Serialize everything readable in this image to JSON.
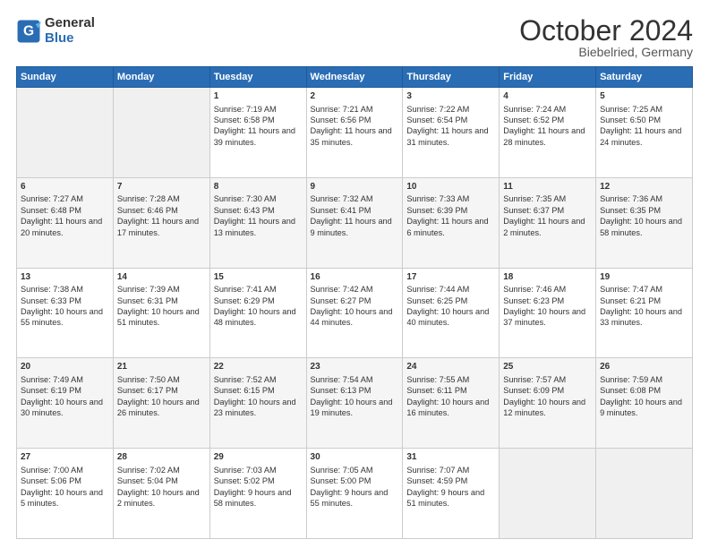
{
  "logo": {
    "line1": "General",
    "line2": "Blue"
  },
  "header": {
    "month": "October 2024",
    "location": "Biebelried, Germany"
  },
  "weekdays": [
    "Sunday",
    "Monday",
    "Tuesday",
    "Wednesday",
    "Thursday",
    "Friday",
    "Saturday"
  ],
  "weeks": [
    [
      {
        "day": "",
        "content": ""
      },
      {
        "day": "",
        "content": ""
      },
      {
        "day": "1",
        "content": "Sunrise: 7:19 AM\nSunset: 6:58 PM\nDaylight: 11 hours and 39 minutes."
      },
      {
        "day": "2",
        "content": "Sunrise: 7:21 AM\nSunset: 6:56 PM\nDaylight: 11 hours and 35 minutes."
      },
      {
        "day": "3",
        "content": "Sunrise: 7:22 AM\nSunset: 6:54 PM\nDaylight: 11 hours and 31 minutes."
      },
      {
        "day": "4",
        "content": "Sunrise: 7:24 AM\nSunset: 6:52 PM\nDaylight: 11 hours and 28 minutes."
      },
      {
        "day": "5",
        "content": "Sunrise: 7:25 AM\nSunset: 6:50 PM\nDaylight: 11 hours and 24 minutes."
      }
    ],
    [
      {
        "day": "6",
        "content": "Sunrise: 7:27 AM\nSunset: 6:48 PM\nDaylight: 11 hours and 20 minutes."
      },
      {
        "day": "7",
        "content": "Sunrise: 7:28 AM\nSunset: 6:46 PM\nDaylight: 11 hours and 17 minutes."
      },
      {
        "day": "8",
        "content": "Sunrise: 7:30 AM\nSunset: 6:43 PM\nDaylight: 11 hours and 13 minutes."
      },
      {
        "day": "9",
        "content": "Sunrise: 7:32 AM\nSunset: 6:41 PM\nDaylight: 11 hours and 9 minutes."
      },
      {
        "day": "10",
        "content": "Sunrise: 7:33 AM\nSunset: 6:39 PM\nDaylight: 11 hours and 6 minutes."
      },
      {
        "day": "11",
        "content": "Sunrise: 7:35 AM\nSunset: 6:37 PM\nDaylight: 11 hours and 2 minutes."
      },
      {
        "day": "12",
        "content": "Sunrise: 7:36 AM\nSunset: 6:35 PM\nDaylight: 10 hours and 58 minutes."
      }
    ],
    [
      {
        "day": "13",
        "content": "Sunrise: 7:38 AM\nSunset: 6:33 PM\nDaylight: 10 hours and 55 minutes."
      },
      {
        "day": "14",
        "content": "Sunrise: 7:39 AM\nSunset: 6:31 PM\nDaylight: 10 hours and 51 minutes."
      },
      {
        "day": "15",
        "content": "Sunrise: 7:41 AM\nSunset: 6:29 PM\nDaylight: 10 hours and 48 minutes."
      },
      {
        "day": "16",
        "content": "Sunrise: 7:42 AM\nSunset: 6:27 PM\nDaylight: 10 hours and 44 minutes."
      },
      {
        "day": "17",
        "content": "Sunrise: 7:44 AM\nSunset: 6:25 PM\nDaylight: 10 hours and 40 minutes."
      },
      {
        "day": "18",
        "content": "Sunrise: 7:46 AM\nSunset: 6:23 PM\nDaylight: 10 hours and 37 minutes."
      },
      {
        "day": "19",
        "content": "Sunrise: 7:47 AM\nSunset: 6:21 PM\nDaylight: 10 hours and 33 minutes."
      }
    ],
    [
      {
        "day": "20",
        "content": "Sunrise: 7:49 AM\nSunset: 6:19 PM\nDaylight: 10 hours and 30 minutes."
      },
      {
        "day": "21",
        "content": "Sunrise: 7:50 AM\nSunset: 6:17 PM\nDaylight: 10 hours and 26 minutes."
      },
      {
        "day": "22",
        "content": "Sunrise: 7:52 AM\nSunset: 6:15 PM\nDaylight: 10 hours and 23 minutes."
      },
      {
        "day": "23",
        "content": "Sunrise: 7:54 AM\nSunset: 6:13 PM\nDaylight: 10 hours and 19 minutes."
      },
      {
        "day": "24",
        "content": "Sunrise: 7:55 AM\nSunset: 6:11 PM\nDaylight: 10 hours and 16 minutes."
      },
      {
        "day": "25",
        "content": "Sunrise: 7:57 AM\nSunset: 6:09 PM\nDaylight: 10 hours and 12 minutes."
      },
      {
        "day": "26",
        "content": "Sunrise: 7:59 AM\nSunset: 6:08 PM\nDaylight: 10 hours and 9 minutes."
      }
    ],
    [
      {
        "day": "27",
        "content": "Sunrise: 7:00 AM\nSunset: 5:06 PM\nDaylight: 10 hours and 5 minutes."
      },
      {
        "day": "28",
        "content": "Sunrise: 7:02 AM\nSunset: 5:04 PM\nDaylight: 10 hours and 2 minutes."
      },
      {
        "day": "29",
        "content": "Sunrise: 7:03 AM\nSunset: 5:02 PM\nDaylight: 9 hours and 58 minutes."
      },
      {
        "day": "30",
        "content": "Sunrise: 7:05 AM\nSunset: 5:00 PM\nDaylight: 9 hours and 55 minutes."
      },
      {
        "day": "31",
        "content": "Sunrise: 7:07 AM\nSunset: 4:59 PM\nDaylight: 9 hours and 51 minutes."
      },
      {
        "day": "",
        "content": ""
      },
      {
        "day": "",
        "content": ""
      }
    ]
  ]
}
